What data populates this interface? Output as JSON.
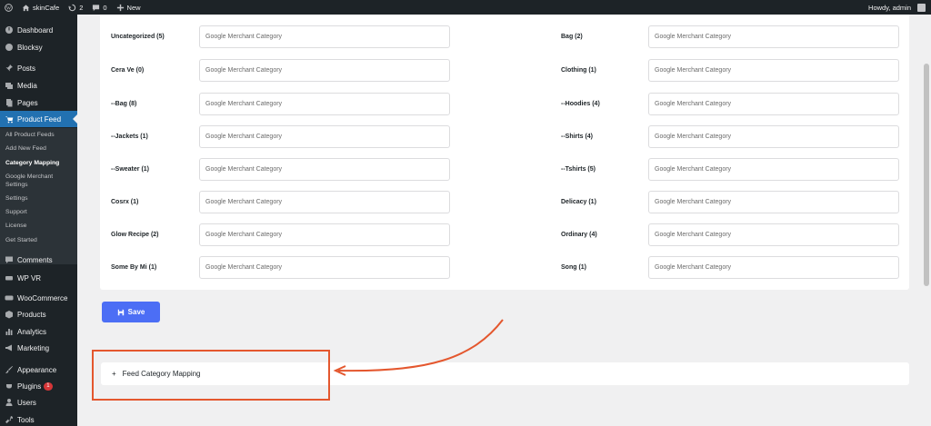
{
  "adminbar": {
    "site_name": "skinCafe",
    "updates": "2",
    "comments": "0",
    "new_label": "New",
    "howdy": "Howdy, admin"
  },
  "sidebar": {
    "items": [
      {
        "label": "Dashboard",
        "icon": "dashboard-icon"
      },
      {
        "label": "Blocksy",
        "icon": "blocksy-icon"
      },
      {
        "label": "Posts",
        "icon": "pin-icon"
      },
      {
        "label": "Media",
        "icon": "media-icon"
      },
      {
        "label": "Pages",
        "icon": "pages-icon"
      },
      {
        "label": "Product Feed",
        "icon": "cart-icon"
      },
      {
        "label": "Comments",
        "icon": "comment-icon"
      },
      {
        "label": "WP VR",
        "icon": "vr-icon"
      },
      {
        "label": "WooCommerce",
        "icon": "woo-icon"
      },
      {
        "label": "Products",
        "icon": "products-icon"
      },
      {
        "label": "Analytics",
        "icon": "analytics-icon"
      },
      {
        "label": "Marketing",
        "icon": "megaphone-icon"
      },
      {
        "label": "Appearance",
        "icon": "brush-icon"
      },
      {
        "label": "Plugins",
        "icon": "plug-icon",
        "badge": "1"
      },
      {
        "label": "Users",
        "icon": "users-icon"
      },
      {
        "label": "Tools",
        "icon": "wrench-icon"
      }
    ],
    "submenu": [
      "All Product Feeds",
      "Add New Feed",
      "Category Mapping",
      "Google Merchant Settings",
      "Settings",
      "Support",
      "License",
      "Get Started"
    ]
  },
  "mapping": {
    "placeholder": "Google Merchant Category",
    "left": [
      "Uncategorized (5)",
      "Cera Ve (0)",
      "--Bag (8)",
      "--Jackets (1)",
      "--Sweater (1)",
      "Cosrx (1)",
      "Glow Recipe (2)",
      "Some By Mi (1)"
    ],
    "right": [
      "Bag (2)",
      "Clothing (1)",
      "--Hoodies (4)",
      "--Shirts (4)",
      "--Tshirts (5)",
      "Delicacy (1)",
      "Ordinary (4)",
      "Song (1)"
    ]
  },
  "save_label": "Save",
  "accordion": {
    "label": "Feed Category Mapping",
    "toggle": "+"
  },
  "colors": {
    "accent": "#4c6ef5",
    "admin_dark": "#1d2327",
    "highlight": "#e4572e",
    "current_menu": "#2271b1"
  }
}
